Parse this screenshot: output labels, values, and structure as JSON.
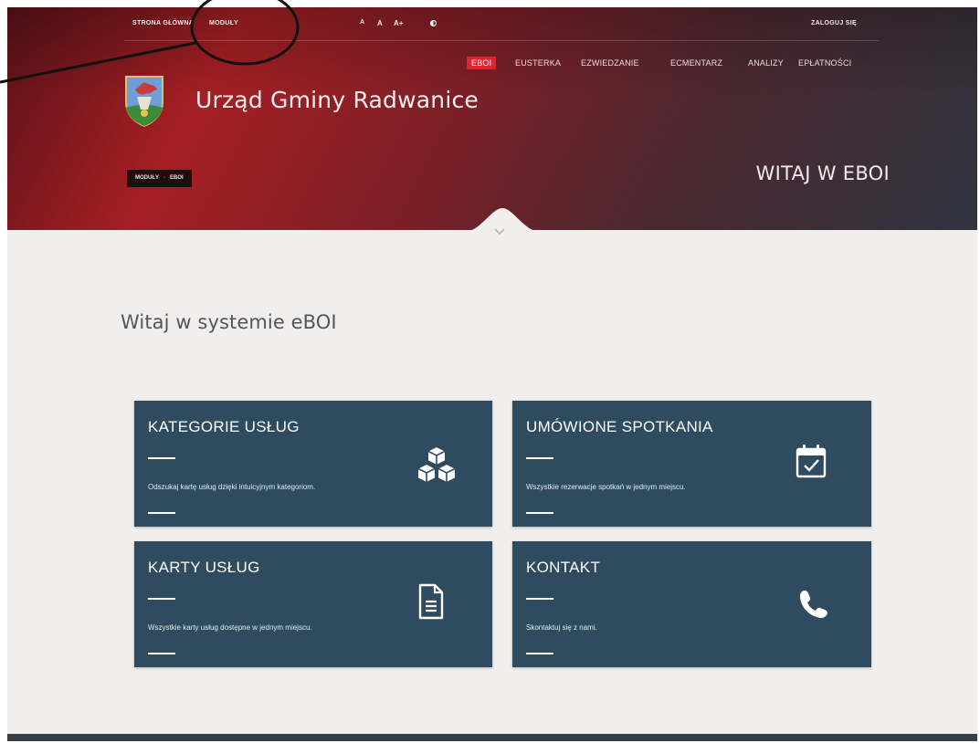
{
  "topbar": {
    "home_link": "STRONA GŁÓWNA",
    "modules_link": "MODUŁY",
    "font_small": "A",
    "font_medium": "A",
    "font_large": "A+",
    "login_link": "ZALOGUJ SIĘ"
  },
  "site": {
    "title": "Urząd Gminy Radwanice"
  },
  "main_nav": [
    {
      "label": "EBOI",
      "active": true
    },
    {
      "label": "EUSTERKA",
      "active": false
    },
    {
      "label": "EZWIEDZANIE",
      "active": false
    },
    {
      "label": "ECMENTARZ",
      "active": false
    },
    {
      "label": "ANALIZY",
      "active": false
    },
    {
      "label": "EPŁATNOŚCI",
      "active": false
    }
  ],
  "breadcrumb": {
    "root": "MODUŁY",
    "current": "EBOI"
  },
  "hero": {
    "welcome": "WITAJ W EBOI"
  },
  "content": {
    "heading": "Witaj w systemie eBOI"
  },
  "cards": [
    {
      "title": "KATEGORIE USŁUG",
      "description": "Odszukaj kartę usług dzięki intuicyjnym kategoriom.",
      "icon": "cubes-icon"
    },
    {
      "title": "UMÓWIONE SPOTKANIA",
      "description": "Wszystkie rezerwacje spotkań w jednym miejscu.",
      "icon": "calendar-check-icon"
    },
    {
      "title": "KARTY USŁUG",
      "description": "Wszystkie karty usług dostępne w jednym miejscu.",
      "icon": "document-icon"
    },
    {
      "title": "KONTAKT",
      "description": "Skontaktuj się z nami.",
      "icon": "phone-icon"
    }
  ],
  "colors": {
    "hero_red": "#a51f24",
    "hero_dark": "#2f3440",
    "card_bg": "#2f4b5f",
    "active_nav": "#d7262d",
    "page_bg": "#f1eeee"
  }
}
